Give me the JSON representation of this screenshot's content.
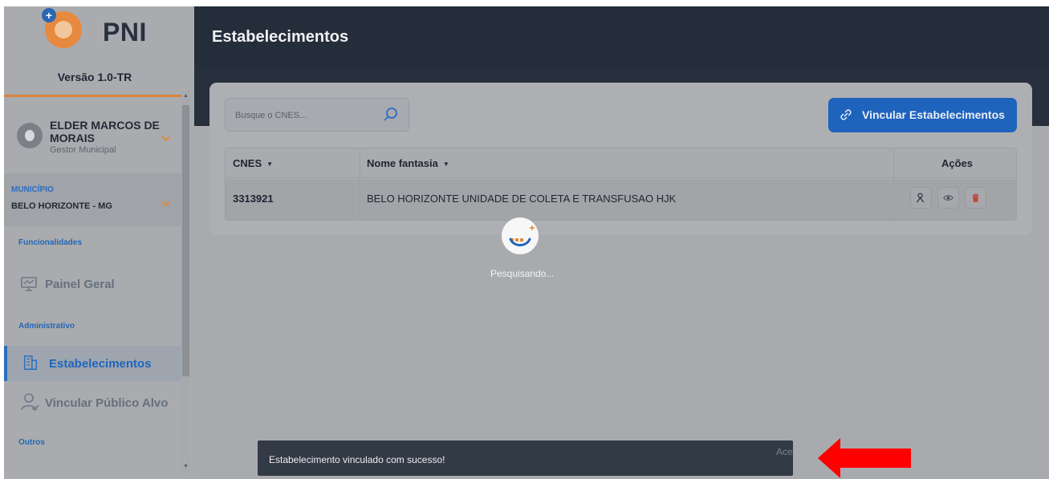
{
  "app": {
    "name": "PNI",
    "version": "Versão 1.0-TR"
  },
  "user": {
    "name": "ELDER MARCOS DE MORAIS",
    "role": "Gestor Municipal"
  },
  "municipio": {
    "label": "MUNICÍPIO",
    "value": "BELO HORIZONTE - MG"
  },
  "sidebar": {
    "sections": [
      {
        "title": "Funcionalidades"
      },
      {
        "title": "Administrativo"
      },
      {
        "title": "Outros"
      }
    ],
    "items": [
      {
        "label": "Painel Geral",
        "icon": "dashboard-icon"
      },
      {
        "label": "Estabelecimentos",
        "icon": "building-icon",
        "active": true
      },
      {
        "label": "Vincular Público Alvo",
        "icon": "user-icon"
      }
    ]
  },
  "header": {
    "title": "Estabelecimentos"
  },
  "search": {
    "placeholder": "Busque o CNES..."
  },
  "link_button": {
    "label": "Vincular Estabelecimentos"
  },
  "table": {
    "columns": [
      "CNES",
      "Nome fantasia",
      "Ações"
    ],
    "rows": [
      {
        "cnes": "3313921",
        "nome": "BELO HORIZONTE UNIDADE DE COLETA E TRANSFUSAO HJK"
      }
    ]
  },
  "loader": {
    "text": "Pesquisando..."
  },
  "toast": {
    "message": "Estabelecimento vinculado com sucesso!",
    "action": "Ace"
  },
  "colors": {
    "accent": "#1e63bc",
    "header": "#242d3a",
    "brand_orange": "#e7893e",
    "arrow": "#ff0000"
  }
}
